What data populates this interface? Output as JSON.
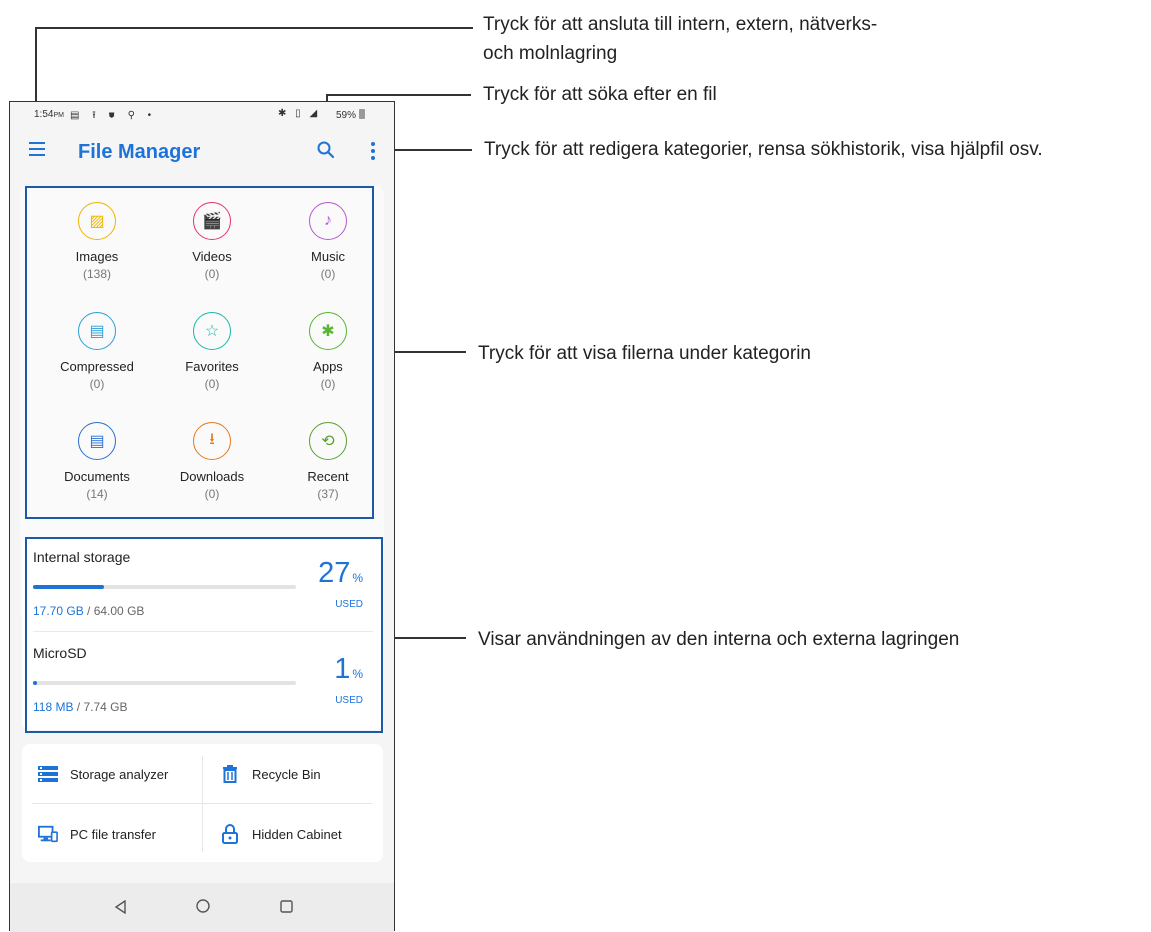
{
  "status_bar": {
    "time": "1:54",
    "ampm": "PM",
    "left_icons": "▤ ⭱ ⛊ ⚲ •",
    "right_icons": "✱ ▯ ◢",
    "battery": "59%"
  },
  "app_bar": {
    "title": "File Manager"
  },
  "categories": [
    {
      "label": "Images",
      "count": "(138)",
      "icon": "image-icon",
      "color": "#f0b400",
      "glyph": "▨"
    },
    {
      "label": "Videos",
      "count": "(0)",
      "icon": "video-icon",
      "color": "#e8336b",
      "glyph": "🎬"
    },
    {
      "label": "Music",
      "count": "(0)",
      "icon": "music-icon",
      "color": "#b45ad0",
      "glyph": "♪"
    },
    {
      "label": "Compressed",
      "count": "(0)",
      "icon": "compressed-icon",
      "color": "#2a9fd6",
      "glyph": "▤"
    },
    {
      "label": "Favorites",
      "count": "(0)",
      "icon": "star-icon",
      "color": "#1bb7a8",
      "glyph": "☆"
    },
    {
      "label": "Apps",
      "count": "(0)",
      "icon": "android-icon",
      "color": "#5bb532",
      "glyph": "✱"
    },
    {
      "label": "Documents",
      "count": "(14)",
      "icon": "document-icon",
      "color": "#2a6fd0",
      "glyph": "▤"
    },
    {
      "label": "Downloads",
      "count": "(0)",
      "icon": "download-icon",
      "color": "#e07a20",
      "glyph": "⭳"
    },
    {
      "label": "Recent",
      "count": "(37)",
      "icon": "history-icon",
      "color": "#5aa02c",
      "glyph": "⟲"
    }
  ],
  "storage": [
    {
      "name": "Internal storage",
      "used": "17.70 GB",
      "total": " / 64.00 GB",
      "percent": "27",
      "percent_symbol": "%",
      "used_label": "USED",
      "fraction": 0.27
    },
    {
      "name": "MicroSD",
      "used": "118 MB",
      "total": " / 7.74 GB",
      "percent": "1",
      "percent_symbol": "%",
      "used_label": "USED",
      "fraction": 0.01
    }
  ],
  "tools": [
    {
      "label": "Storage analyzer",
      "icon": "storage-analyzer-icon"
    },
    {
      "label": "Recycle Bin",
      "icon": "trash-icon"
    },
    {
      "label": "PC file transfer",
      "icon": "pc-transfer-icon"
    },
    {
      "label": "Hidden Cabinet",
      "icon": "lock-icon"
    }
  ],
  "callouts": {
    "menu": "Tryck för att ansluta till intern, extern, nätverks-\noch molnlagring",
    "search": "Tryck för att söka efter en fil",
    "more": "Tryck för att redigera kategorier, rensa sökhistorik, visa hjälpfil osv.",
    "categories": "Tryck för att visa filerna under kategorin",
    "storage": "Visar användningen av den interna och externa lagringen"
  },
  "colors": {
    "accent": "#1e73d8",
    "highlight": "#1a5aa6"
  }
}
